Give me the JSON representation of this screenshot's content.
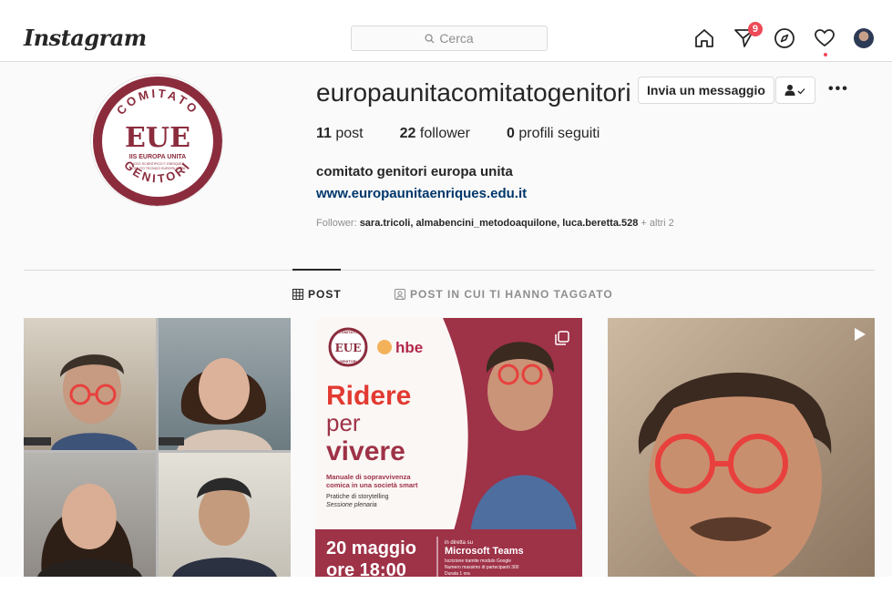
{
  "nav": {
    "logo": "Instagram",
    "search_placeholder": "Cerca",
    "activity_badge": "9"
  },
  "profile": {
    "username": "europaunitacomitatogenitori",
    "message_button": "Invia un messaggio",
    "more": "•••",
    "stats": [
      {
        "count": "11",
        "label": "post"
      },
      {
        "count": "22",
        "label": "follower"
      },
      {
        "count": "0",
        "label": "profili seguiti"
      }
    ],
    "full_name": "comitato genitori europa unita",
    "website": "www.europaunitaenriques.edu.it",
    "followed_by_prefix": "Follower:",
    "followed_by_names": "sara.tricoli, almabencini_metodoaquilone, luca.beretta.528",
    "followed_by_more": "+ altri 2",
    "logo": {
      "top": "COMITATO",
      "mark": "EUE",
      "school": "IIS EUROPA UNITA",
      "line1": "LICEO SCIENTIFICO F. ENRIQUES",
      "line2": "ISTITUTO TECNICO EUROPA UNITA",
      "bottom": "GENITORI"
    }
  },
  "tabs": [
    {
      "label": "POST",
      "icon": "grid-icon",
      "active": true
    },
    {
      "label": "POST IN CUI TI HANNO TAGGATO",
      "icon": "tag-icon",
      "active": false
    }
  ],
  "posts": {
    "poster": {
      "comitato": "COMITATO",
      "genitori": "GENITORI",
      "brand": "hbe",
      "title1": "Ridere",
      "title2": "per",
      "title3": "vivere",
      "subtitle1": "Manuale di sopravvivenza",
      "subtitle2": "comica in una società smart",
      "pratiche1": "Pratiche di storytelling",
      "pratiche2": "Sessione plenaria",
      "date": "20 maggio",
      "time": "ore 18:00",
      "live_label": "in diretta su",
      "platform": "Microsoft Teams",
      "info1": "Iscrizione tramite modulo Google",
      "info2": "Numero massimo di partecipanti 300",
      "info3": "Durata 1 ora"
    }
  },
  "colors": {
    "accent": "#ed4956",
    "link": "#00376b",
    "burgundy": "#8b2c3d"
  }
}
